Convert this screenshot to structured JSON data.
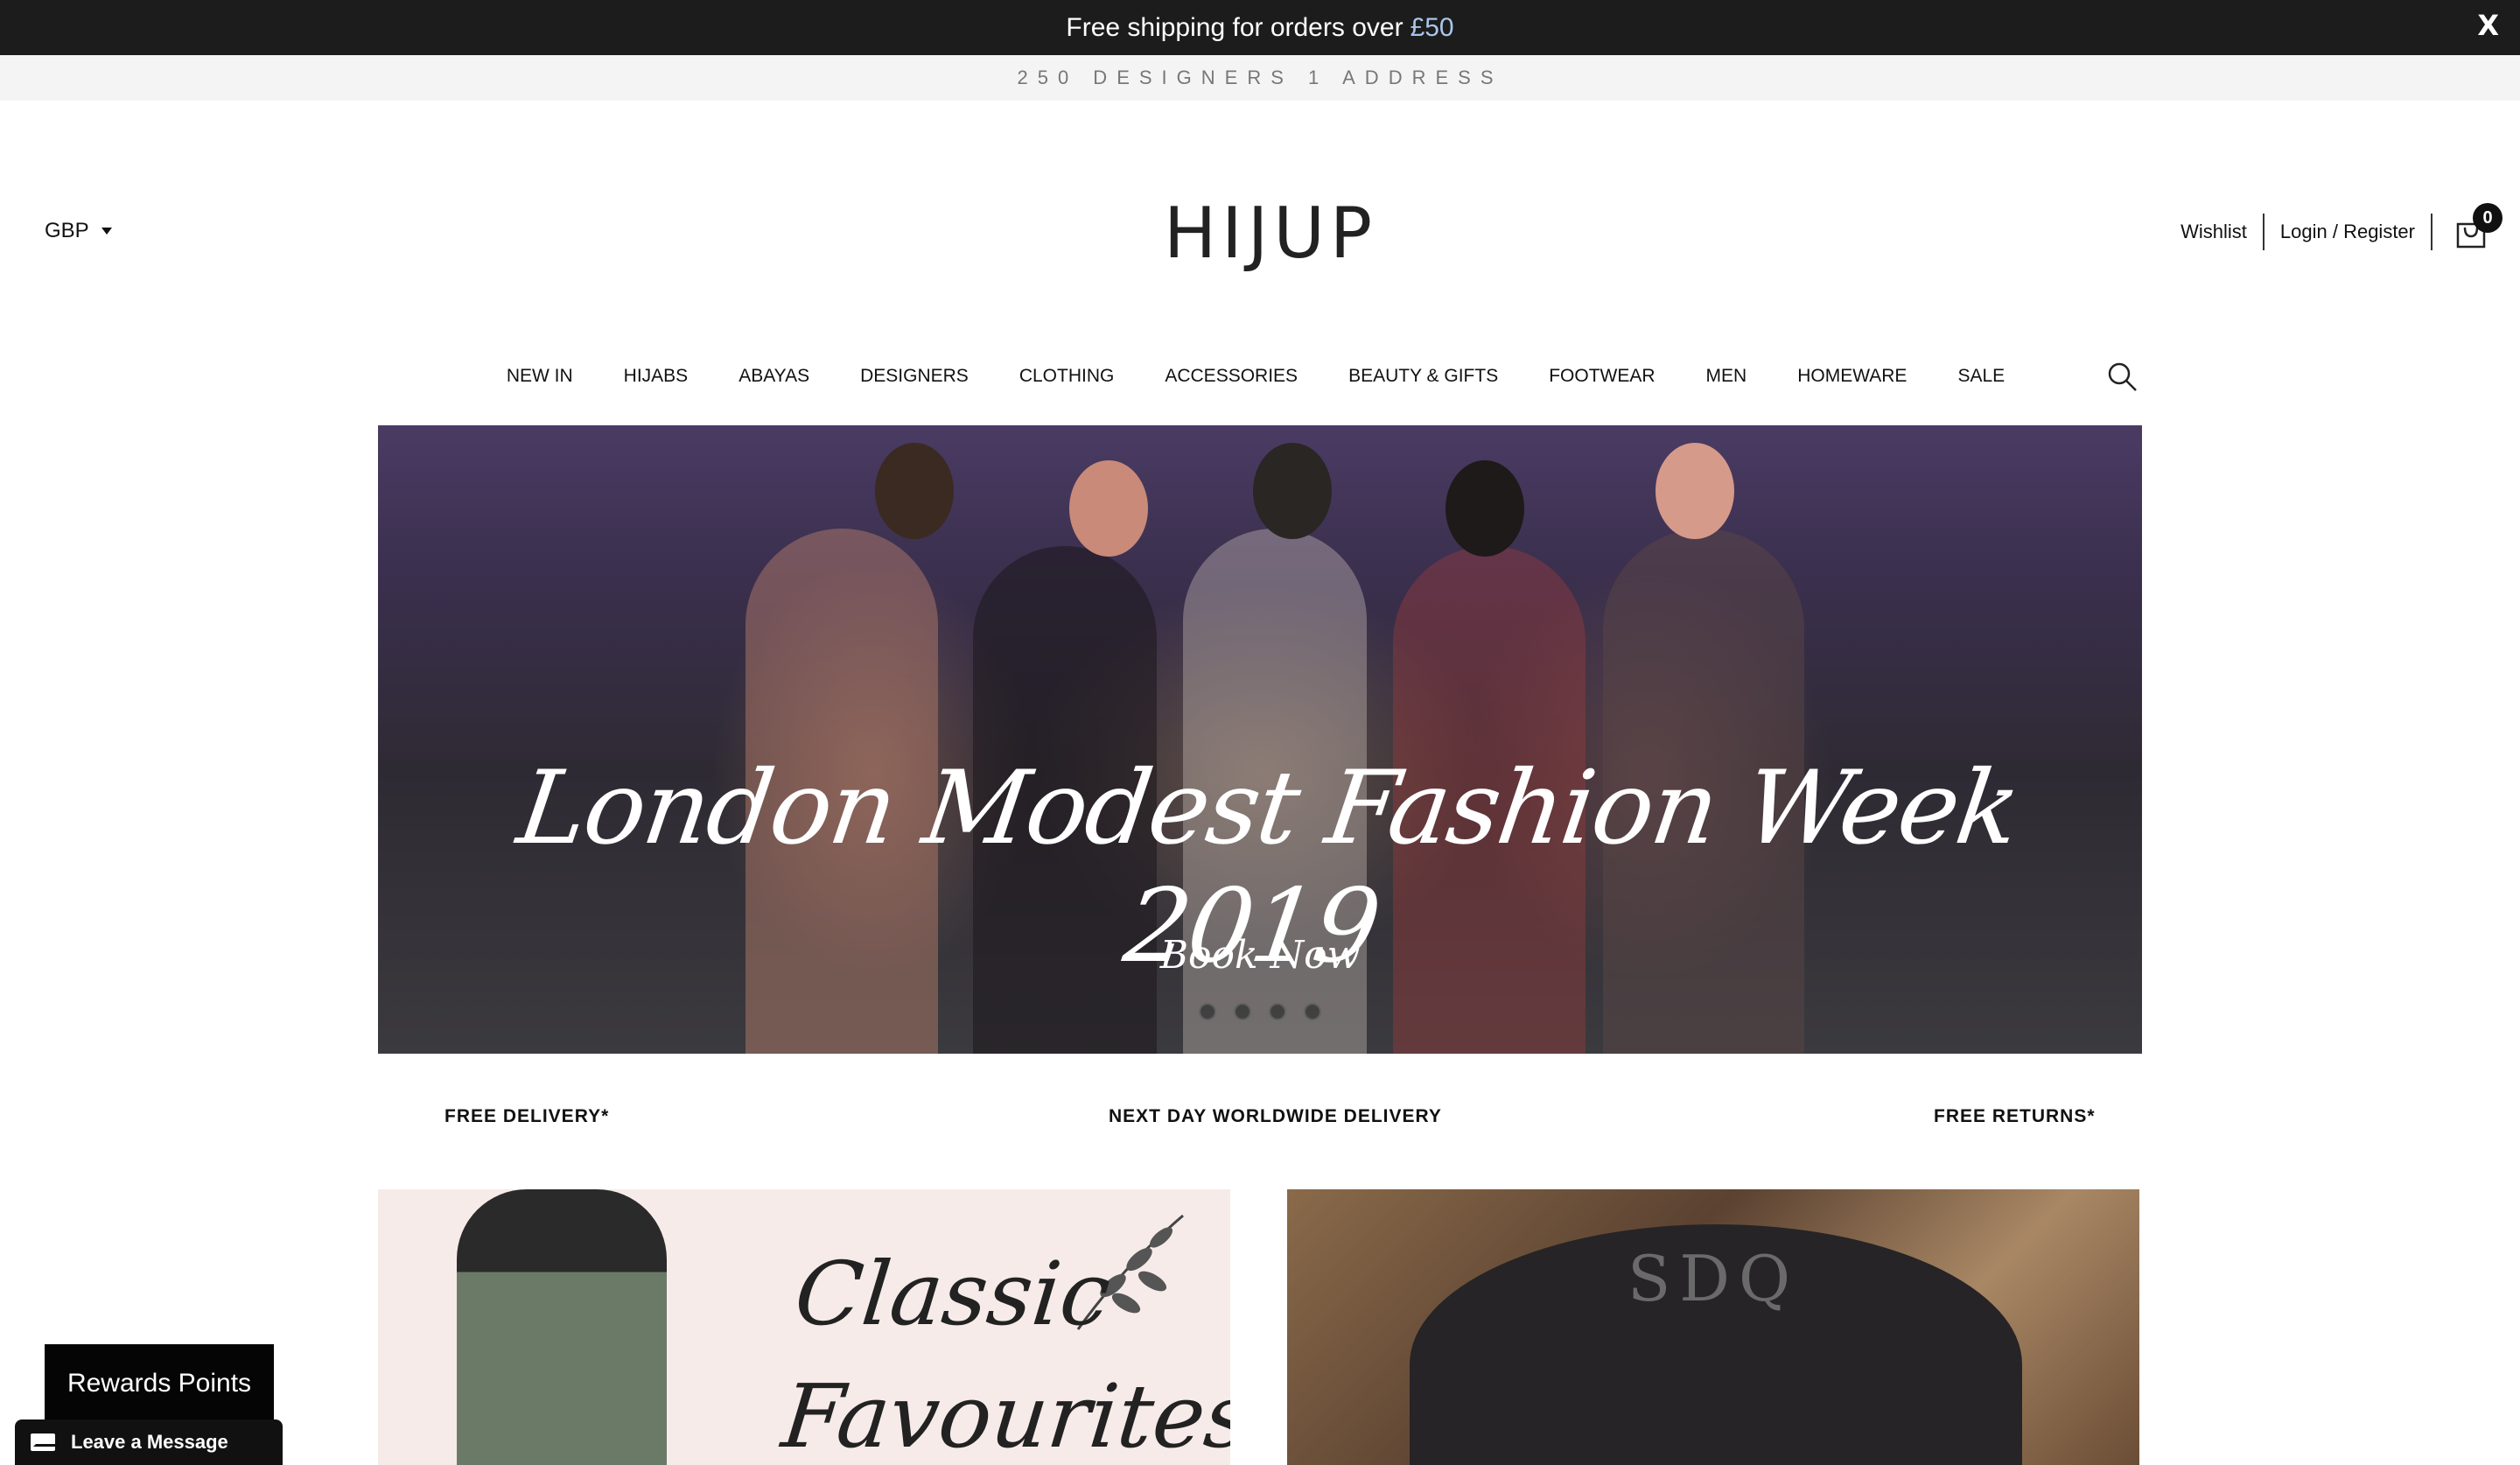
{
  "promo": {
    "text": "Free shipping for orders over",
    "amount": "£50",
    "close_label": "X"
  },
  "tagline": "250 DESIGNERS 1 ADDRESS",
  "header": {
    "currency": "GBP",
    "logo": "HIJUP",
    "wishlist": "Wishlist",
    "login": "Login / Register",
    "cart_count": "0"
  },
  "nav": {
    "items": [
      "NEW IN",
      "HIJABS",
      "ABAYAS",
      "DESIGNERS",
      "CLOTHING",
      "ACCESSORIES",
      "BEAUTY & GIFTS",
      "FOOTWEAR",
      "MEN",
      "HOMEWARE",
      "SALE"
    ]
  },
  "hero": {
    "title": "London Modest Fashion Week 2019",
    "cta": "Book Now",
    "slide_count": 4,
    "active_slide": 1
  },
  "benefits": [
    "FREE DELIVERY*",
    "NEXT DAY WORLDWIDE DELIVERY",
    "FREE RETURNS*"
  ],
  "tiles": {
    "left_text_line1": "Classic",
    "left_text_line2": "Favourites",
    "right_text": "SDQ"
  },
  "widgets": {
    "rewards": "Rewards Points",
    "leave_message": "Leave a Message"
  },
  "colors": {
    "promo_bg": "#1c1c1c",
    "promo_amount": "#a9c6ea",
    "tagline_bg": "#f4f4f4"
  }
}
